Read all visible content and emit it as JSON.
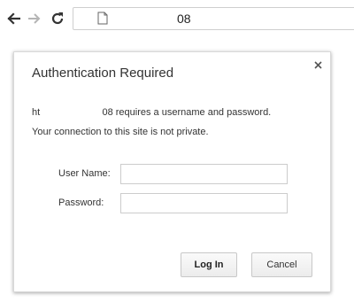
{
  "browser": {
    "back_icon": "arrow-left-icon",
    "forward_icon": "arrow-right-icon",
    "reload_icon": "reload-icon",
    "page_icon": "document-icon",
    "url": "08"
  },
  "dialog": {
    "title": "Authentication Required",
    "close_icon": "close-icon",
    "message_line1": "ht                       08 requires a username and password.",
    "message_line2": "Your connection to this site is not private.",
    "username_label": "User Name:",
    "username_value": "",
    "password_label": "Password:",
    "password_value": "",
    "login_label": "Log In",
    "cancel_label": "Cancel"
  },
  "colors": {
    "background": "#ffffff",
    "text": "#333333",
    "border": "#cccccc"
  }
}
